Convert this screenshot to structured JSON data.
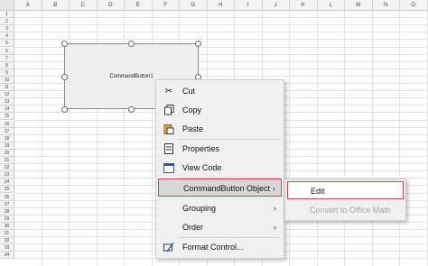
{
  "sheet": {
    "columns": [
      "A",
      "B",
      "C",
      "D",
      "E",
      "F",
      "G",
      "H",
      "I",
      "J",
      "K",
      "L",
      "M",
      "N",
      "O"
    ],
    "rows": [
      "1",
      "2",
      "3",
      "4",
      "5",
      "6",
      "7",
      "8",
      "9",
      "10",
      "11",
      "12",
      "13",
      "14",
      "15",
      "16",
      "17",
      "18",
      "19",
      "20",
      "21",
      "22",
      "23",
      "24",
      "25",
      "26",
      "27",
      "28",
      "29",
      "30",
      "31",
      "32",
      "33",
      "34"
    ]
  },
  "command_button": {
    "caption": "CommandButton1"
  },
  "context_menu": {
    "items": [
      {
        "label": "Cut",
        "icon": "scissors-icon"
      },
      {
        "label": "Copy",
        "icon": "copy-icon"
      },
      {
        "label": "Paste",
        "icon": "paste-icon"
      },
      {
        "label": "Properties",
        "icon": "properties-icon"
      },
      {
        "label": "View Code",
        "icon": "view-code-icon"
      },
      {
        "label": "CommandButton Object",
        "has_submenu": true
      },
      {
        "label": "Grouping",
        "has_submenu": true
      },
      {
        "label": "Order",
        "has_submenu": true
      },
      {
        "label": "Format Control...",
        "icon": "format-control-icon"
      }
    ]
  },
  "submenu": {
    "items": [
      {
        "label": "Edit",
        "enabled": true
      },
      {
        "label": "Convert to Office Math",
        "enabled": false
      }
    ]
  },
  "colors": {
    "highlight_border": "#d0474a",
    "menu_bg": "#f0f0f0"
  }
}
